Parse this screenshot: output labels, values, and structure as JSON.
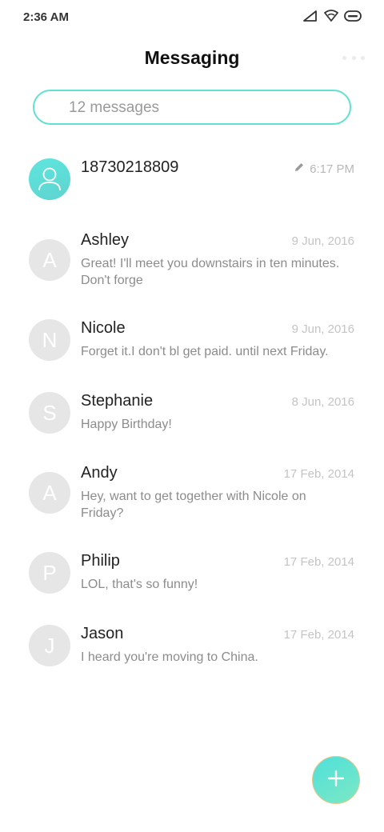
{
  "status_bar": {
    "time": "2:36 AM",
    "icons": [
      "signal-icon",
      "wifi-icon",
      "battery-icon"
    ]
  },
  "header": {
    "title": "Messaging",
    "more_icon": "more-dots-icon"
  },
  "search": {
    "text": "12 messages"
  },
  "conversations": [
    {
      "name": "18730218809",
      "date": "6:17 PM",
      "snippet": "",
      "avatar": "person-icon",
      "draft": true
    },
    {
      "name": "Ashley",
      "date": "9 Jun, 2016",
      "snippet": "Great! I'll meet you downstairs in ten minutes. Don't forge",
      "avatar": "A"
    },
    {
      "name": "Nicole",
      "date": "9 Jun, 2016",
      "snippet": "Forget it.I don't bl get paid. until next Friday.",
      "avatar": "N"
    },
    {
      "name": "Stephanie",
      "date": "8 Jun, 2016",
      "snippet": "Happy Birthday!",
      "avatar": "S"
    },
    {
      "name": "Andy",
      "date": "17 Feb, 2014",
      "snippet": "Hey, want to get together with Nicole on Friday?",
      "avatar": "A"
    },
    {
      "name": "Philip",
      "date": "17 Feb, 2014",
      "snippet": "LOL, that's so funny!",
      "avatar": "P"
    },
    {
      "name": "Jason",
      "date": "17 Feb, 2014",
      "snippet": "I heard you're moving to China.",
      "avatar": "J"
    }
  ],
  "fab": {
    "icon": "plus-icon"
  },
  "colors": {
    "accent": "#62e0d0",
    "avatar_bg": "#e6e6e6",
    "date": "#c4c4c4",
    "snippet": "#8c8c8c"
  }
}
